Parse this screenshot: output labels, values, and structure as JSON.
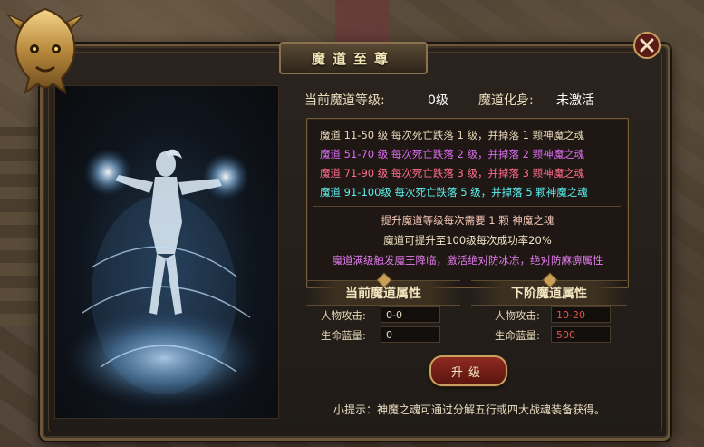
{
  "dialog": {
    "title": "魔道至尊",
    "close_icon": "close-x-icon"
  },
  "status": {
    "level_label": "当前魔道等级:",
    "level_value": "0级",
    "avatar_label": "魔道化身:",
    "avatar_value": "未激活"
  },
  "drop_rules": [
    {
      "text": "魔道 11-50 级 每次死亡跌落 1 级，并掉落 1 颗神魔之魂",
      "color": "#e8d7b8"
    },
    {
      "text": "魔道 51-70 级 每次死亡跌落 2 级，并掉落 2 颗神魔之魂",
      "color": "#d86cf0"
    },
    {
      "text": "魔道 71-90 级 每次死亡跌落 3 级，并掉落 3 颗神魔之魂",
      "color": "#ff6c8c"
    },
    {
      "text": "魔道 91-100级 每次死亡跌落 5 级，并掉落 5 颗神魔之魂",
      "color": "#5cf0f0"
    }
  ],
  "notes": [
    {
      "text": "提升魔道等级每次需要 1 颗 神魔之魂",
      "color": "#f4c6b6"
    },
    {
      "text": "魔道可提升至100级每次成功率20%",
      "color": "#f2e4c8"
    },
    {
      "text": "魔道满级触发魔王降临，激活绝对防冰冻，绝对防麻痹属性",
      "color": "#e67cf0"
    }
  ],
  "current_attrs": {
    "header": "当前魔道属性",
    "attack_label": "人物攻击:",
    "attack_value": "0-0",
    "hp_label": "生命蓝量:",
    "hp_value": "0"
  },
  "next_attrs": {
    "header": "下阶魔道属性",
    "attack_label": "人物攻击:",
    "attack_value": "10-20",
    "hp_label": "生命蓝量:",
    "hp_value": "500"
  },
  "upgrade_button": "升级",
  "tip": "小提示：神魔之魂可通过分解五行或四大战魂装备获得。",
  "colors": {
    "next_value": "#e0584a",
    "current_value": "#e8dcc0",
    "frame_gold": "#8b7150"
  }
}
